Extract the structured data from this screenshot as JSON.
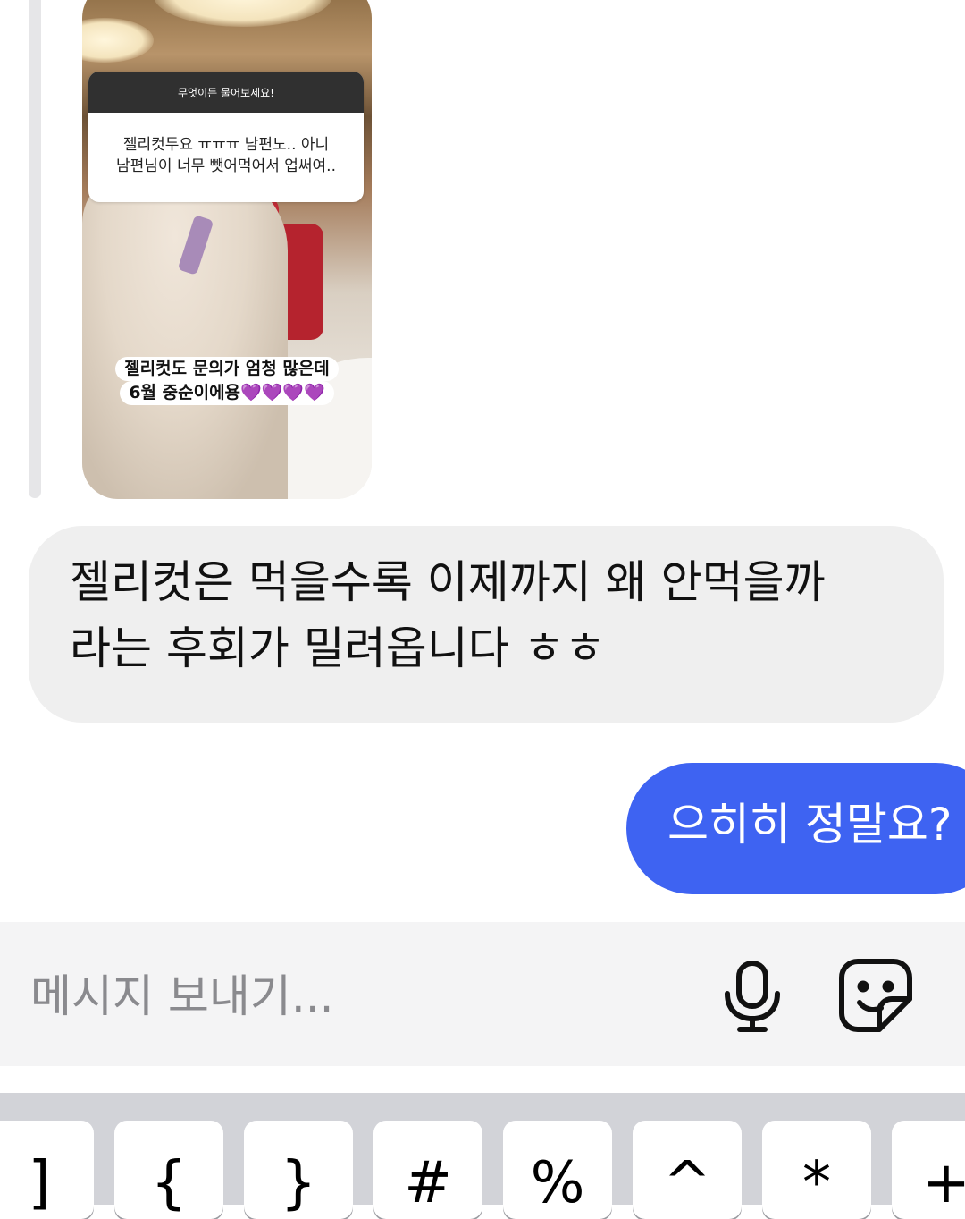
{
  "story_reply": {
    "question_header": "무엇이든 물어보세요!",
    "question_answer": "젤리컷두요 ㅠㅠㅠ 남편노.. 아니\n남편님이 너무 뺏어먹어서 업써여..",
    "caption_line1": "젤리컷도 문의가 엄청 많은데",
    "caption_line2": "6월 중순이에용💜💜💜💜"
  },
  "messages": {
    "incoming": "젤리컷은 먹을수록 이제까지 왜 안먹을까\n라는 후회가 밀려옵니다 ㅎㅎ",
    "outgoing": "으히히 정말요?"
  },
  "composer": {
    "placeholder": "메시지 보내기...",
    "mic_icon": "microphone-icon",
    "sticker_icon": "sticker-icon"
  },
  "keyboard": {
    "keys": [
      "]",
      "{",
      "}",
      "#",
      "%",
      "^",
      "*",
      "+"
    ]
  },
  "colors": {
    "outgoing_bubble": "#3e63f2",
    "incoming_bubble": "#efefef",
    "composer_bg": "#f4f4f5",
    "keyboard_bg": "#d2d3d8"
  }
}
